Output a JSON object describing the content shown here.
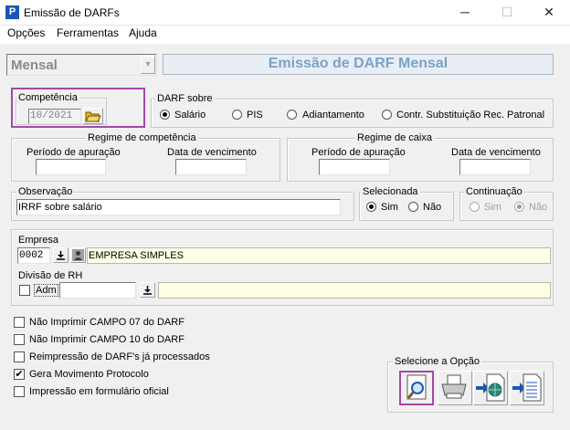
{
  "window": {
    "title": "Emissão de DARFs",
    "minimize": "─",
    "maximize": "☐",
    "close": "✕"
  },
  "menu": [
    "Opções",
    "Ferramentas",
    "Ajuda"
  ],
  "header": {
    "mode_value": "Mensal",
    "title": "Emissão de DARF Mensal"
  },
  "competencia": {
    "label": "Competência",
    "value": "10/2021"
  },
  "darf_sobre": {
    "label": "DARF sobre",
    "options": [
      "Salário",
      "PIS",
      "Adiantamento",
      "Contr. Substituição Rec. Patronal"
    ],
    "selected": "Salário"
  },
  "regime_competencia": {
    "label": "Regime de competência",
    "periodo_label": "Período de apuração",
    "vencimento_label": "Data de vencimento",
    "periodo_value": "",
    "vencimento_value": ""
  },
  "regime_caixa": {
    "label": "Regime de caixa",
    "periodo_label": "Período de apuração",
    "vencimento_label": "Data de vencimento",
    "periodo_value": "",
    "vencimento_value": ""
  },
  "observacao": {
    "label": "Observação",
    "value": "IRRF sobre salário"
  },
  "selecionada": {
    "label": "Selecionada",
    "options": [
      "Sim",
      "Não"
    ],
    "selected": "Sim"
  },
  "continuacao": {
    "label": "Continuação",
    "options": [
      "Sim",
      "Não"
    ],
    "selected": "Não"
  },
  "empresa": {
    "label": "Empresa",
    "code": "0002",
    "name": "EMPRESA SIMPLES"
  },
  "divisao": {
    "label": "Divisão de RH",
    "adm_label": "Adm",
    "value": "",
    "description": ""
  },
  "options": [
    {
      "label": "Não Imprimir CAMPO 07 do DARF",
      "checked": false
    },
    {
      "label": "Não Imprimir CAMPO 10 do DARF",
      "checked": false
    },
    {
      "label": "Reimpressão de DARF's já processados",
      "checked": false
    },
    {
      "label": "Gera Movimento Protocolo",
      "checked": true
    },
    {
      "label": "Impressão em formulário oficial",
      "checked": false
    }
  ],
  "selecione": {
    "label": "Selecione a Opção",
    "buttons": [
      "preview-icon",
      "printer-icon",
      "export-web-icon",
      "export-file-icon"
    ]
  },
  "colors": {
    "highlight": "#a349a4",
    "header_text": "#7aa2c8",
    "accent_blue": "#1a56b8"
  },
  "glyphs": {
    "check": "✔",
    "down": "▼",
    "dropdown": "▾",
    "folder": "📂",
    "app": "P"
  }
}
